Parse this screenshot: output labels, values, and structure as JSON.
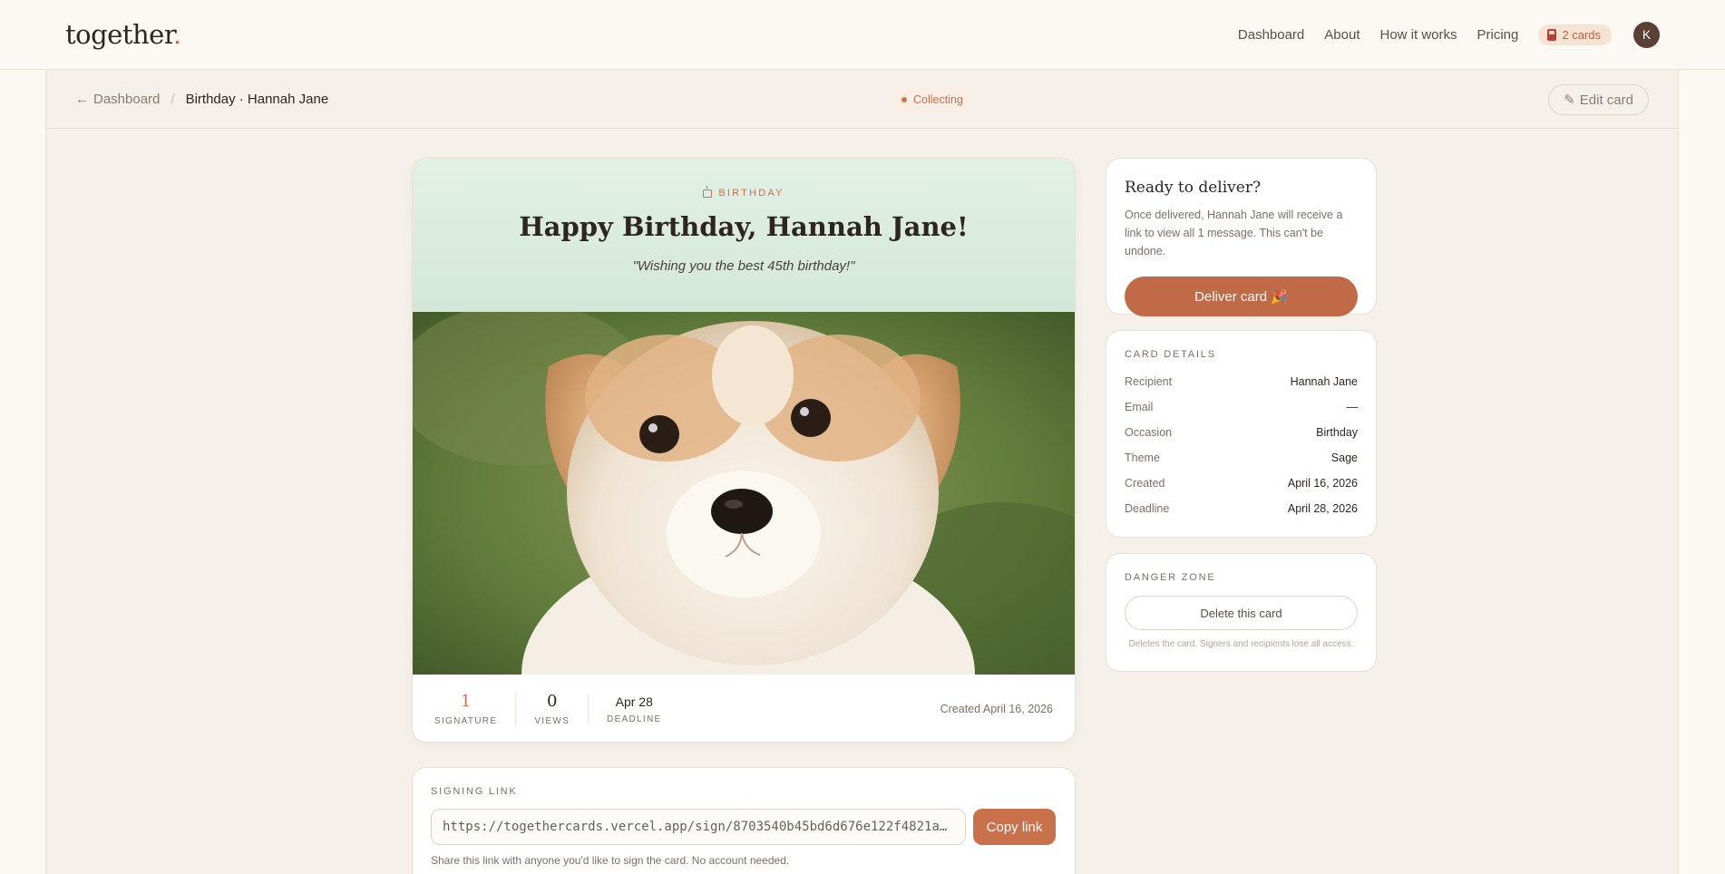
{
  "brand": {
    "name": "together",
    "dot": "."
  },
  "nav": {
    "links": [
      "Dashboard",
      "About",
      "How it works",
      "Pricing"
    ],
    "cards_badge": "2 cards",
    "avatar_initial": "K"
  },
  "subbar": {
    "back_label": "Dashboard",
    "current": "Birthday · Hannah Jane",
    "status": "Collecting",
    "edit_label": "Edit card"
  },
  "card": {
    "occasion": "BIRTHDAY",
    "title": "Happy Birthday, Hannah Jane!",
    "message": "\"Wishing you the best 45th birthday!\"",
    "photo_desc": "puppy",
    "stats": [
      {
        "value": "1",
        "label": "SIGNATURE"
      },
      {
        "value": "0",
        "label": "VIEWS"
      },
      {
        "value": "Apr 28",
        "label": "DEADLINE"
      }
    ],
    "created": "Created April 16, 2026"
  },
  "signing": {
    "label": "SIGNING LINK",
    "url": "https://togethercards.vercel.app/sign/8703540b45bd6d676e122f4821a…",
    "copy_label": "Copy link",
    "note": "Share this link with anyone you'd like to sign the card. No account needed."
  },
  "deliver": {
    "title": "Ready to deliver?",
    "text": "Once delivered, Hannah Jane will receive a link to view all 1 message. This can't be undone.",
    "button": "Deliver card 🎉"
  },
  "details": {
    "label": "CARD DETAILS",
    "rows": [
      {
        "k": "Recipient",
        "v": "Hannah Jane"
      },
      {
        "k": "Email",
        "v": "—"
      },
      {
        "k": "Occasion",
        "v": "Birthday"
      },
      {
        "k": "Theme",
        "v": "Sage"
      },
      {
        "k": "Created",
        "v": "April 16, 2026"
      },
      {
        "k": "Deadline",
        "v": "April 28, 2026"
      }
    ]
  },
  "danger": {
    "label": "DANGER ZONE",
    "button": "Delete this card",
    "note": "Deletes the card. Signers and recipients lose all access."
  },
  "colors": {
    "accent": "#c9714a",
    "sage": "#d3e8d8",
    "background": "#fcf8f4"
  }
}
